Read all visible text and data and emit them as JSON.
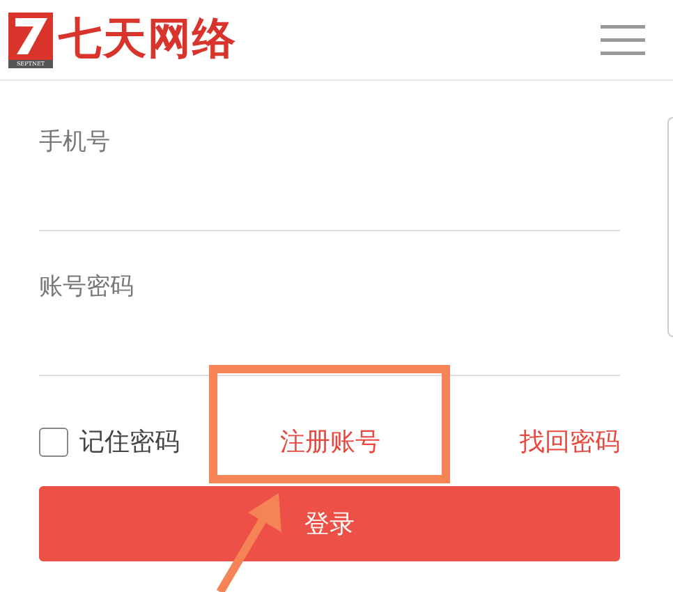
{
  "header": {
    "logo_mark": "SEPTNET",
    "brand": "七天网络"
  },
  "fields": [
    {
      "placeholder": "手机号"
    },
    {
      "placeholder": "账号密码"
    }
  ],
  "remember": {
    "label": "记住密码",
    "checked": false
  },
  "links": [
    {
      "label": "注册账号"
    },
    {
      "label": "找回密码"
    }
  ],
  "login_button": "登录"
}
